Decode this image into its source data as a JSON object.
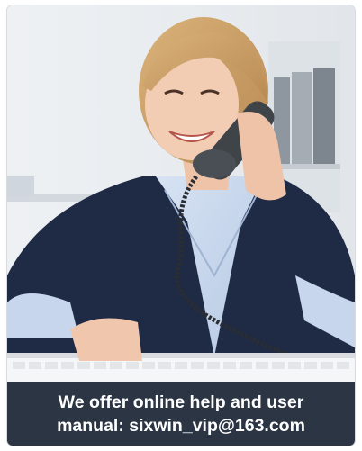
{
  "image": {
    "subject": "smiling-woman-on-phone-at-keyboard"
  },
  "caption": {
    "line1": "We offer online help and user",
    "line2": "manual: sixwin_vip@163.com"
  },
  "colors": {
    "caption_bg": "#2b3543",
    "caption_text": "#ffffff",
    "blazer": "#1f2a44",
    "shirt": "#c9d8ee"
  }
}
